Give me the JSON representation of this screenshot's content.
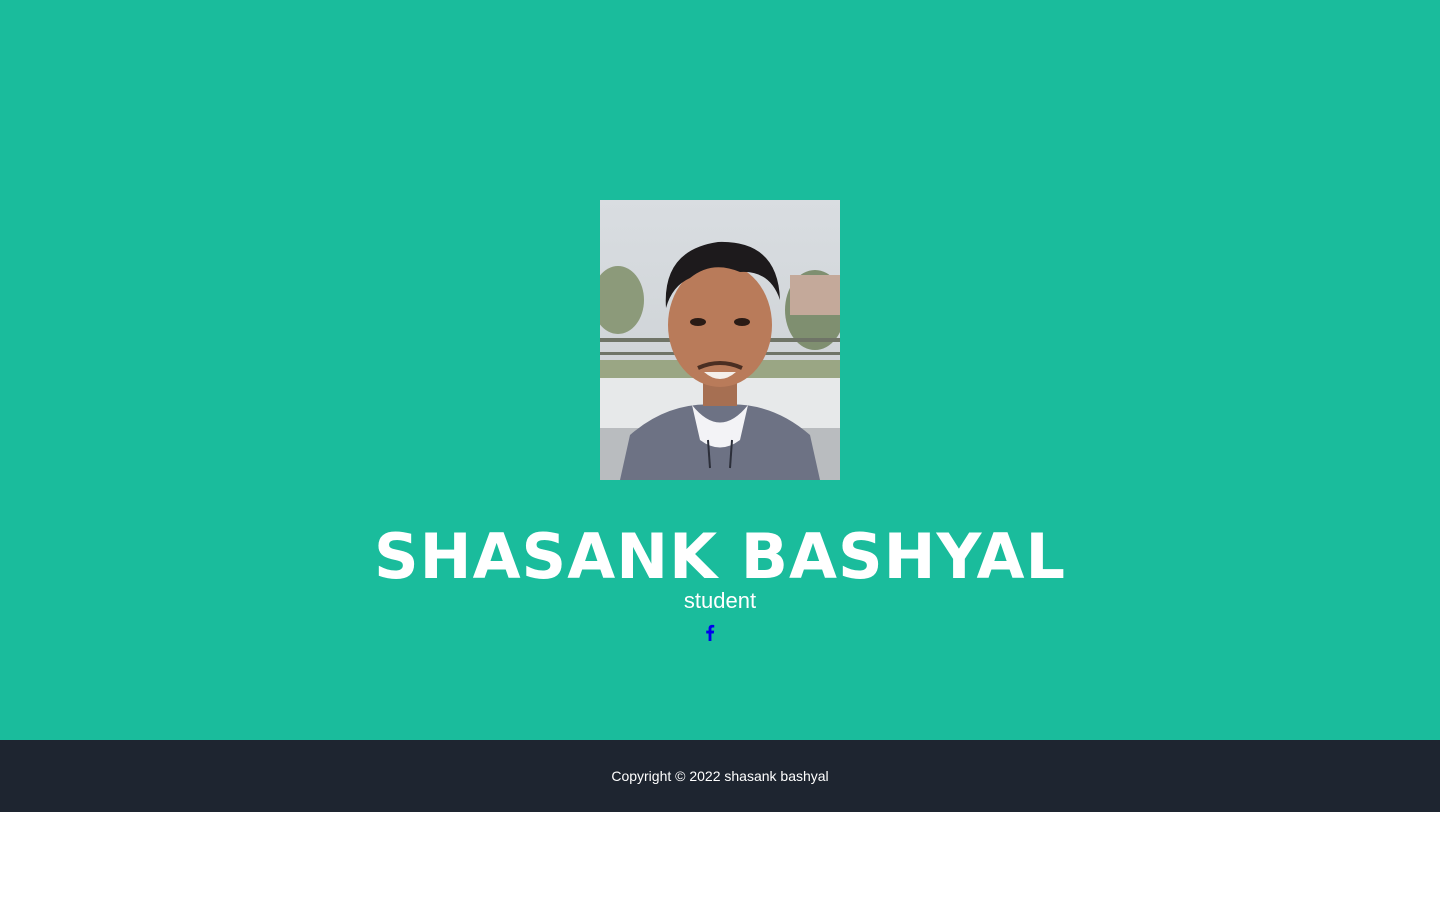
{
  "profile": {
    "name": "SHASANK BASHYAL",
    "role": "student",
    "photo_alt": "profile-photo",
    "social": [
      {
        "icon": "facebook-icon",
        "color": "#0000ee"
      }
    ]
  },
  "footer": {
    "copyright": "Copyright © 2022 shasank bashyal"
  },
  "colors": {
    "primary": "#1abc9c",
    "footer_bg": "#1e2530",
    "text": "#ffffff",
    "link": "#0000ee"
  }
}
